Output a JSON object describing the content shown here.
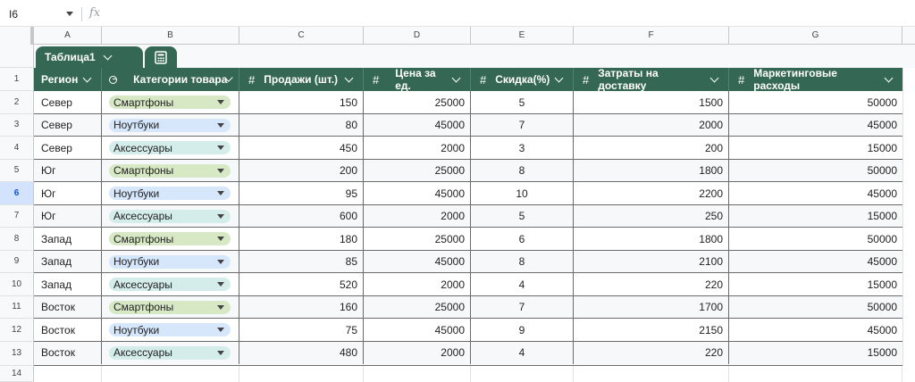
{
  "formula_bar": {
    "cell_ref": "I6",
    "fx": "fx",
    "formula": ""
  },
  "columns": [
    "A",
    "B",
    "C",
    "D",
    "E",
    "F",
    "G"
  ],
  "rows": [
    "1",
    "2",
    "3",
    "4",
    "5",
    "6",
    "7",
    "8",
    "9",
    "10",
    "11",
    "12",
    "13",
    "14"
  ],
  "active_row": "6",
  "table": {
    "name": "Таблица1",
    "headers": {
      "region": "Регион",
      "category": "Категории товара",
      "sales": "Продажи (шт.)",
      "price": "Цена за ед.",
      "discount": "Скидка(%)",
      "delivery": "Затраты на доставку",
      "marketing": "Маркетинговые расходы"
    },
    "hash": "#",
    "chip_colors": {
      "Смартфоны": "#d7e8c4",
      "Ноутбуки": "#d6e6fb",
      "Аксессуары": "#d4ecea"
    },
    "header_color": "#356854",
    "data": [
      {
        "region": "Север",
        "category": "Смартфоны",
        "sales": "150",
        "price": "25000",
        "discount": "5",
        "delivery": "1500",
        "marketing": "50000"
      },
      {
        "region": "Север",
        "category": "Ноутбуки",
        "sales": "80",
        "price": "45000",
        "discount": "7",
        "delivery": "2000",
        "marketing": "45000"
      },
      {
        "region": "Север",
        "category": "Аксессуары",
        "sales": "450",
        "price": "2000",
        "discount": "3",
        "delivery": "200",
        "marketing": "15000"
      },
      {
        "region": "Юг",
        "category": "Смартфоны",
        "sales": "200",
        "price": "25000",
        "discount": "8",
        "delivery": "1800",
        "marketing": "50000"
      },
      {
        "region": "Юг",
        "category": "Ноутбуки",
        "sales": "95",
        "price": "45000",
        "discount": "10",
        "delivery": "2200",
        "marketing": "45000"
      },
      {
        "region": "Юг",
        "category": "Аксессуары",
        "sales": "600",
        "price": "2000",
        "discount": "5",
        "delivery": "250",
        "marketing": "15000"
      },
      {
        "region": "Запад",
        "category": "Смартфоны",
        "sales": "180",
        "price": "25000",
        "discount": "6",
        "delivery": "1800",
        "marketing": "50000"
      },
      {
        "region": "Запад",
        "category": "Ноутбуки",
        "sales": "85",
        "price": "45000",
        "discount": "8",
        "delivery": "2100",
        "marketing": "45000"
      },
      {
        "region": "Запад",
        "category": "Аксессуары",
        "sales": "520",
        "price": "2000",
        "discount": "4",
        "delivery": "220",
        "marketing": "15000"
      },
      {
        "region": "Восток",
        "category": "Смартфоны",
        "sales": "160",
        "price": "25000",
        "discount": "7",
        "delivery": "1700",
        "marketing": "50000"
      },
      {
        "region": "Восток",
        "category": "Ноутбуки",
        "sales": "75",
        "price": "45000",
        "discount": "9",
        "delivery": "2150",
        "marketing": "45000"
      },
      {
        "region": "Восток",
        "category": "Аксессуары",
        "sales": "480",
        "price": "2000",
        "discount": "4",
        "delivery": "220",
        "marketing": "15000"
      }
    ]
  }
}
